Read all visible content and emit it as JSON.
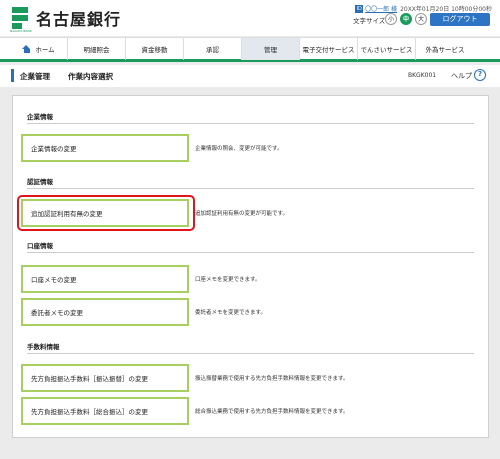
{
  "header": {
    "bank_name": "名古屋銀行",
    "logo_sub": "NAGOYA BANK",
    "user_name": "〇〇一郎 様",
    "login_time": "20XX年01月20日 10時00分00秒",
    "text_size_label": "文字サイズ",
    "size_small": "小",
    "size_mid": "中",
    "size_large": "大",
    "logout": "ログアウト"
  },
  "nav": {
    "items": [
      {
        "label": "ホーム"
      },
      {
        "label": "明細照会"
      },
      {
        "label": "資金移動"
      },
      {
        "label": "承認"
      },
      {
        "label": "管理"
      },
      {
        "label": "電子交付サービス"
      },
      {
        "label": "でんさいサービス"
      },
      {
        "label": "外為サービス"
      }
    ]
  },
  "title": {
    "main": "企業管理",
    "sub": "作業内容選択",
    "screen_id": "BKGK001",
    "help": "ヘルプ"
  },
  "sections": {
    "company": {
      "title": "企業情報",
      "items": [
        {
          "label": "企業情報の変更",
          "desc": "企業情報の照会、変更が可能です。"
        }
      ]
    },
    "auth": {
      "title": "認証情報",
      "items": [
        {
          "label": "追加認証利用有無の変更",
          "desc": "追加認証利用有無の変更が可能です。"
        }
      ]
    },
    "account": {
      "title": "口座情報",
      "items": [
        {
          "label": "口座メモの変更",
          "desc": "口座メモを変更できます。"
        },
        {
          "label": "委託者メモの変更",
          "desc": "委託者メモを変更できます。"
        }
      ]
    },
    "fees": {
      "title": "手数料情報",
      "items": [
        {
          "label": "先方負担振込手数料［振込振替］の変更",
          "desc": "振込振替業務で使用する先方負担手数料情報を変更できます。"
        },
        {
          "label": "先方負担振込手数料［総合振込］の変更",
          "desc": "総合振込業務で使用する先方負担手数料情報を変更できます。"
        }
      ]
    }
  },
  "colors": {
    "accent_green": "#1a9a5b",
    "button_border": "#a7cf62",
    "link_blue": "#2a6fb8",
    "highlight_red": "#e0141c"
  }
}
